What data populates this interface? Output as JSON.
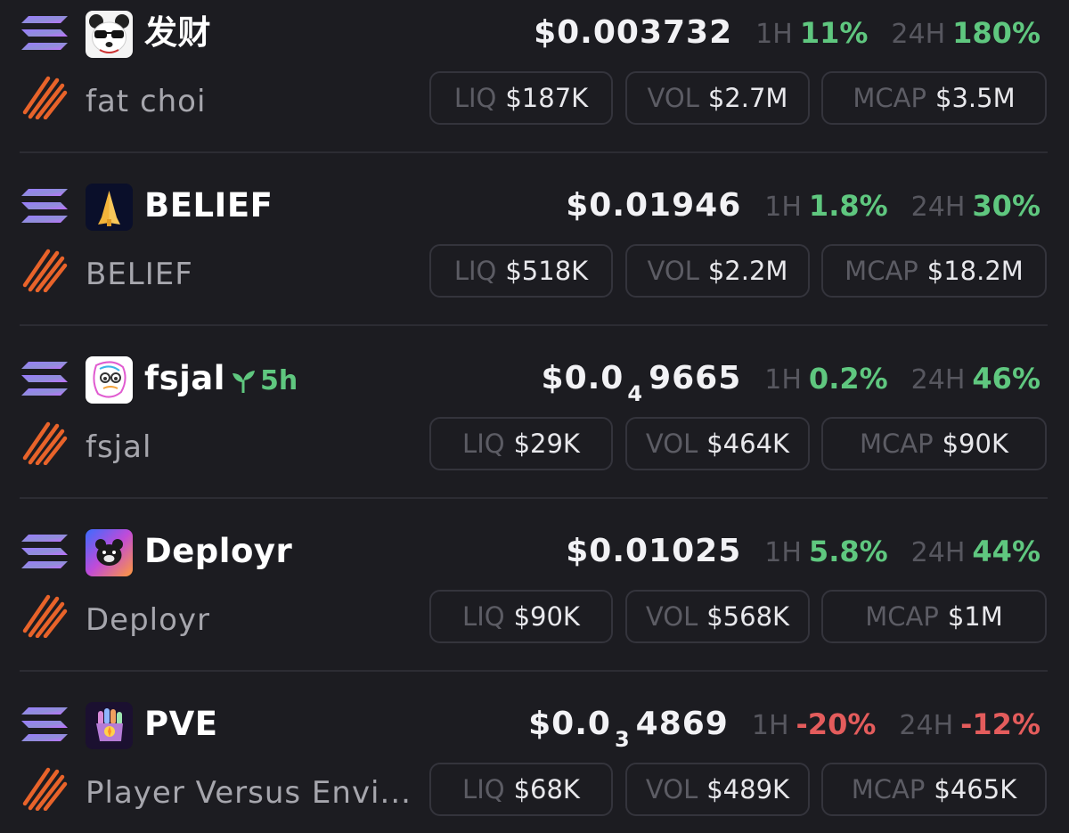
{
  "colors": {
    "background": "#1c1c21",
    "positive": "#5fc77f",
    "negative": "#e45c5c",
    "muted": "#57575f",
    "border": "#34343c"
  },
  "icons": {
    "chain": "solana-icon",
    "dex": "dex-stripes-icon",
    "age": "sprout-icon"
  },
  "labels": {
    "h1": "1H",
    "h24": "24H",
    "liq": "LIQ",
    "vol": "VOL",
    "mcap": "MCAP"
  },
  "tokens": [
    {
      "symbol": "发财",
      "name": "fat choi",
      "age": "",
      "price_main": "$0.003732",
      "price_sub": "",
      "price_tail": "",
      "change_1h": "11%",
      "change_1h_dir": "up",
      "change_24h": "180%",
      "change_24h_dir": "up",
      "liq": "$187K",
      "vol": "$2.7M",
      "mcap": "$3.5M",
      "avatar": "panda-icon"
    },
    {
      "symbol": "BELIEF",
      "name": "BELIEF",
      "age": "",
      "price_main": "$0.01946",
      "price_sub": "",
      "price_tail": "",
      "change_1h": "1.8%",
      "change_1h_dir": "up",
      "change_24h": "30%",
      "change_24h_dir": "up",
      "liq": "$518K",
      "vol": "$2.2M",
      "mcap": "$18.2M",
      "avatar": "praying-hands-icon"
    },
    {
      "symbol": "fsjal",
      "name": "fsjal",
      "age": "5h",
      "price_main": "$0.0",
      "price_sub": "4",
      "price_tail": "9665",
      "change_1h": "0.2%",
      "change_1h_dir": "up",
      "change_24h": "46%",
      "change_24h_dir": "up",
      "liq": "$29K",
      "vol": "$464K",
      "mcap": "$90K",
      "avatar": "fsjal-face-icon"
    },
    {
      "symbol": "Deployr",
      "name": "Deployr",
      "age": "",
      "price_main": "$0.01025",
      "price_sub": "",
      "price_tail": "",
      "change_1h": "5.8%",
      "change_1h_dir": "up",
      "change_24h": "44%",
      "change_24h_dir": "up",
      "liq": "$90K",
      "vol": "$568K",
      "mcap": "$1M",
      "avatar": "bear-icon"
    },
    {
      "symbol": "PVE",
      "name": "Player Versus Envi...",
      "age": "",
      "price_main": "$0.0",
      "price_sub": "3",
      "price_tail": "4869",
      "change_1h": "-20%",
      "change_1h_dir": "down",
      "change_24h": "-12%",
      "change_24h_dir": "down",
      "liq": "$68K",
      "vol": "$489K",
      "mcap": "$465K",
      "avatar": "fist-icon"
    }
  ]
}
